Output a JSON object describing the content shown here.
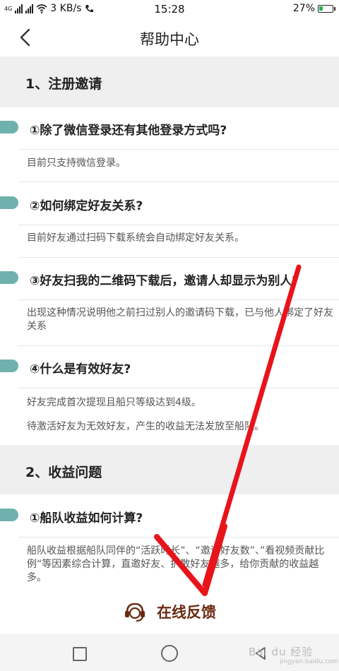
{
  "status_bar": {
    "network_label": "4G",
    "speed": "3 KB/s",
    "time": "15:28",
    "battery": "27%",
    "battery_level": 0.27
  },
  "header": {
    "title": "帮助中心"
  },
  "sections": [
    {
      "title": "1、注册邀请",
      "items": [
        {
          "question": "①除了微信登录还有其他登录方式吗?",
          "answer": "目前只支持微信登录。"
        },
        {
          "question": "②如何绑定好友关系?",
          "answer": "目前好友通过扫码下载系统会自动绑定好友关系。"
        },
        {
          "question": "③好友扫我的二维码下载后，邀请人却显示为别人?",
          "answer": "出现这种情况说明他之前扫过别人的邀请码下载，已与他人绑定了好友关系"
        },
        {
          "question": "④什么是有效好友?",
          "answer": "好友完成首次提现且船只等级达到4级。",
          "answer2": "待激活好友为无效好友，产生的收益无法发放至船队。"
        }
      ]
    },
    {
      "title": "2、收益问题",
      "items": [
        {
          "question": "①船队收益如何计算?",
          "answer": "船队收益根据船队同伴的“活跃时长”、“邀请好友数”、”看视频贡献比例“等因素综合计算，直邀好友、扩散好友越多，给你贡献的收益越多。"
        }
      ]
    }
  ],
  "feedback": {
    "label": "在线反馈"
  },
  "watermark": {
    "brand": "Bai du 经验",
    "url": "jingyan.baidu.com"
  },
  "colors": {
    "accent_pill": "#6fb1ad",
    "section_bg": "#efefef",
    "feedback_text": "#6b2a12",
    "annotation_arrow": "#e8141b"
  }
}
